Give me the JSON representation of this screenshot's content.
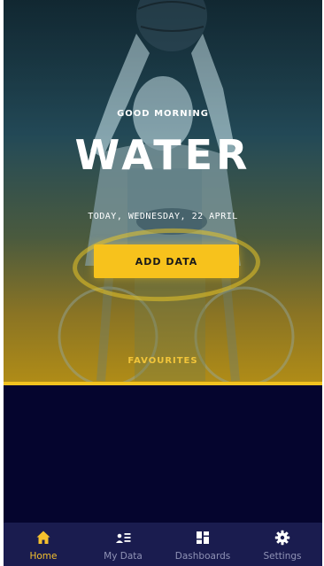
{
  "hero": {
    "greeting": "GOOD MORNING",
    "name": "WATER",
    "date": "TODAY, WEDNESDAY, 22 APRIL",
    "add_button_label": "ADD DATA",
    "favourites_label": "FAVOURITES"
  },
  "tabs": [
    {
      "label": "Home",
      "icon": "home-icon",
      "active": true
    },
    {
      "label": "My Data",
      "icon": "list-icon",
      "active": false
    },
    {
      "label": "Dashboards",
      "icon": "dashboard-icon",
      "active": false
    },
    {
      "label": "Settings",
      "icon": "gear-icon",
      "active": false
    }
  ],
  "colors": {
    "accent": "#f7c21c",
    "background": "#05052e",
    "tabbar": "#1a1c4f",
    "tab_active": "#f4c02e",
    "tab_inactive": "#8f92b5"
  }
}
